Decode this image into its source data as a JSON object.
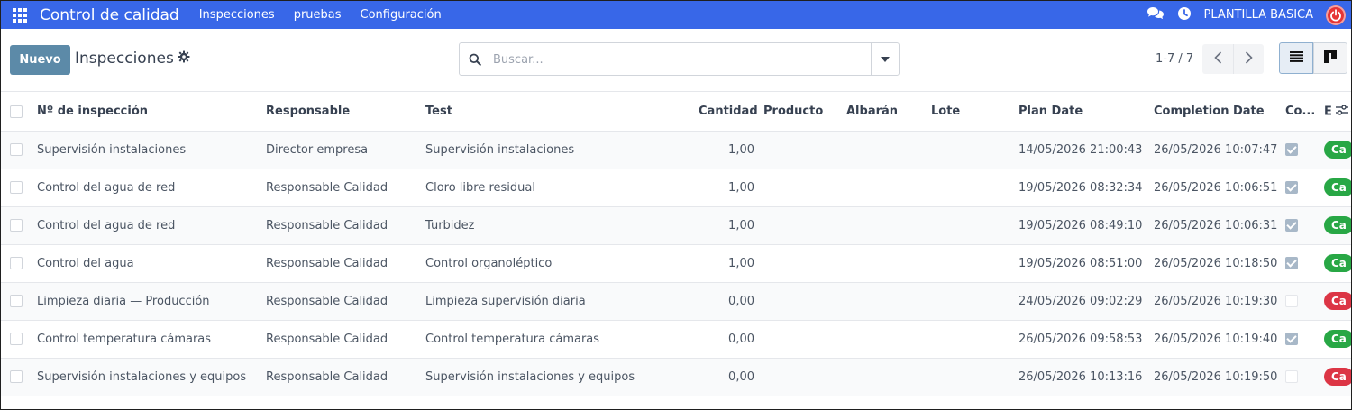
{
  "navbar": {
    "brand": "Control de calidad",
    "menu": [
      "Inspecciones",
      "pruebas",
      "Configuración"
    ],
    "company": "PLANTILLA BASICA"
  },
  "control": {
    "new_label": "Nuevo",
    "breadcrumb": "Inspecciones",
    "search_placeholder": "Buscar...",
    "pager": "1-7 / 7"
  },
  "table": {
    "headers": {
      "number": "Nº de inspección",
      "responsible": "Responsable",
      "test": "Test",
      "quantity": "Cantidad",
      "product": "Producto",
      "picking": "Albarán",
      "lot": "Lote",
      "plan_date": "Plan Date",
      "completion_date": "Completion Date",
      "completed": "Co...",
      "state": "E"
    },
    "rows": [
      {
        "number": "Supervisión instalaciones",
        "responsible": "Director empresa",
        "test": "Supervisión instalaciones",
        "quantity": "1,00",
        "product": "",
        "picking": "",
        "lot": "",
        "plan_date": "14/05/2026 21:00:43",
        "completion_date": "26/05/2026 10:07:47",
        "completed": true,
        "state": "Ca",
        "state_color": "#28a745"
      },
      {
        "number": "Control del agua de red",
        "responsible": "Responsable Calidad",
        "test": "Cloro libre residual",
        "quantity": "1,00",
        "product": "",
        "picking": "",
        "lot": "",
        "plan_date": "19/05/2026 08:32:34",
        "completion_date": "26/05/2026 10:06:51",
        "completed": true,
        "state": "Ca",
        "state_color": "#28a745"
      },
      {
        "number": "Control del agua de red",
        "responsible": "Responsable Calidad",
        "test": "Turbidez",
        "quantity": "1,00",
        "product": "",
        "picking": "",
        "lot": "",
        "plan_date": "19/05/2026 08:49:10",
        "completion_date": "26/05/2026 10:06:31",
        "completed": true,
        "state": "Ca",
        "state_color": "#28a745"
      },
      {
        "number": "Control del agua",
        "responsible": "Responsable Calidad",
        "test": "Control organoléptico",
        "quantity": "1,00",
        "product": "",
        "picking": "",
        "lot": "",
        "plan_date": "19/05/2026 08:51:00",
        "completion_date": "26/05/2026 10:18:50",
        "completed": true,
        "state": "Ca",
        "state_color": "#28a745"
      },
      {
        "number": "Limpieza diaria — Producción",
        "responsible": "Responsable Calidad",
        "test": "Limpieza supervisión diaria",
        "quantity": "0,00",
        "product": "",
        "picking": "",
        "lot": "",
        "plan_date": "24/05/2026 09:02:29",
        "completion_date": "26/05/2026 10:19:30",
        "completed": false,
        "state": "Ca",
        "state_color": "#dc3545"
      },
      {
        "number": "Control temperatura cámaras",
        "responsible": "Responsable Calidad",
        "test": "Control temperatura cámaras",
        "quantity": "0,00",
        "product": "",
        "picking": "",
        "lot": "",
        "plan_date": "26/05/2026 09:58:53",
        "completion_date": "26/05/2026 10:19:40",
        "completed": true,
        "state": "Ca",
        "state_color": "#28a745"
      },
      {
        "number": "Supervisión instalaciones y equipos",
        "responsible": "Responsable Calidad",
        "test": "Supervisión instalaciones y equipos",
        "quantity": "0,00",
        "product": "",
        "picking": "",
        "lot": "",
        "plan_date": "26/05/2026 10:13:16",
        "completion_date": "26/05/2026 10:19:50",
        "completed": false,
        "state": "Ca",
        "state_color": "#dc3545"
      }
    ]
  },
  "colors": {
    "navbar": "#3867e8",
    "primary_button": "#5c8aa8",
    "badge_done": "#28a745",
    "badge_cancel": "#dc3545"
  },
  "icons": [
    "apps-grid-icon",
    "chat-icon",
    "clock-icon",
    "power-icon",
    "gear-icon",
    "search-icon",
    "caret-down-icon",
    "chevron-left-icon",
    "chevron-right-icon",
    "list-view-icon",
    "kanban-view-icon",
    "column-settings-icon"
  ]
}
